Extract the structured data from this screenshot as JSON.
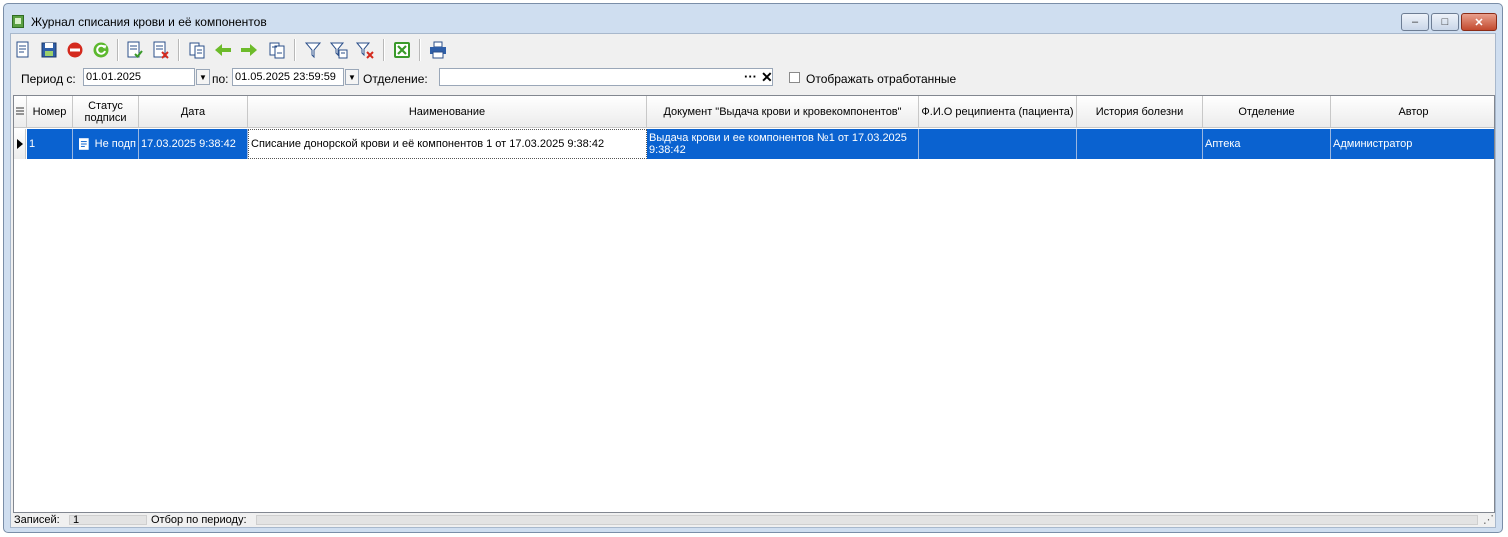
{
  "window": {
    "title": "Журнал списания крови и её компонентов",
    "controls": {
      "minimize": "–",
      "maximize": "□",
      "close": "✕"
    }
  },
  "toolbar": {
    "buttons": [
      {
        "name": "new-document-icon",
        "glyph": "🗎"
      },
      {
        "name": "save-icon",
        "glyph": "💾"
      },
      {
        "name": "stop-icon",
        "glyph": "⛔"
      },
      {
        "name": "refresh-icon",
        "glyph": "⟳"
      },
      {
        "name": "approve-icon",
        "glyph": "✔"
      },
      {
        "name": "reject-icon",
        "glyph": "✘"
      },
      {
        "name": "copy-icon",
        "glyph": "⎘"
      },
      {
        "name": "arrow-left-icon",
        "glyph": "⬅"
      },
      {
        "name": "arrow-right-icon",
        "glyph": "➡"
      },
      {
        "name": "paste-icon",
        "glyph": "⎗"
      },
      {
        "name": "filter-icon",
        "glyph": "⛉"
      },
      {
        "name": "filter-edit-icon",
        "glyph": "⛉"
      },
      {
        "name": "filter-clear-icon",
        "glyph": "⛉"
      },
      {
        "name": "excel-export-icon",
        "glyph": "✖"
      },
      {
        "name": "print-icon",
        "glyph": "⎙"
      }
    ]
  },
  "filter": {
    "period_from_label": "Период с:",
    "period_from_value": "01.01.2025",
    "period_to_label": "по:",
    "period_to_value": "01.05.2025 23:59:59",
    "department_label": "Отделение:",
    "department_value": "",
    "show_processed_label": "Отображать отработанные",
    "show_processed_checked": false
  },
  "table": {
    "columns": [
      "Номер",
      "Статус подписи",
      "Дата",
      "Наименование",
      "Документ \"Выдача крови и кровекомпонентов\"",
      "Ф.И.О реципиента (пациента)",
      "История болезни",
      "Отделение",
      "Автор"
    ],
    "rows": [
      {
        "number": "1",
        "status": "Не подп",
        "date": "17.03.2025 9:38:42",
        "name": "Списание донорской крови и её компонентов 1 от 17.03.2025 9:38:42",
        "document": "Выдача крови и ее компонентов №1 от 17.03.2025 9:38:42",
        "recipient": "",
        "history": "",
        "department": "Аптека",
        "author": "Администратор"
      }
    ]
  },
  "status": {
    "records_label": "Записей:",
    "records_value": "1",
    "period_filter_label": "Отбор по периоду:",
    "period_filter_value": ""
  },
  "colors": {
    "selection": "#0a62d0",
    "window_frame": "#cfdef0"
  }
}
